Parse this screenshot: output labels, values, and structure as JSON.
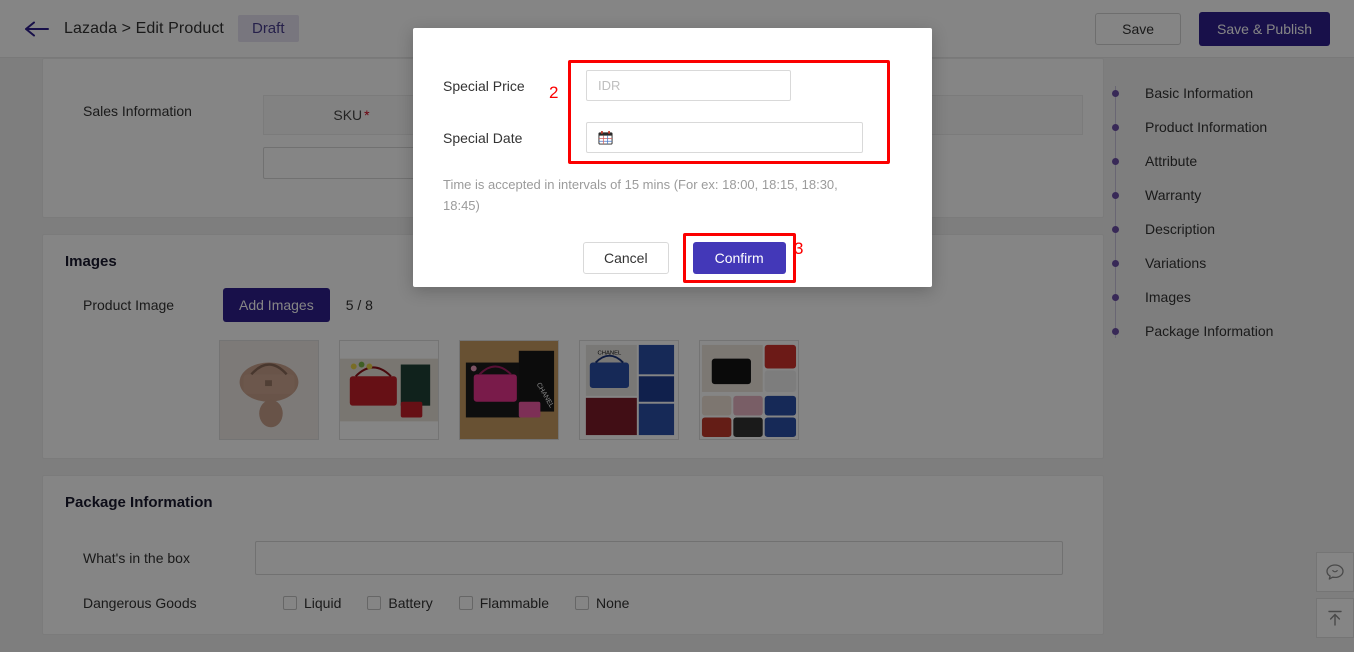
{
  "header": {
    "back_icon": "arrow-left-icon",
    "breadcrumb": "Lazada > Edit Product",
    "status_badge": "Draft",
    "save_label": "Save",
    "publish_label": "Save & Publish"
  },
  "sales_section": {
    "label": "Sales Information",
    "sku_header": "SKU",
    "required_mark": "*"
  },
  "images_section": {
    "title": "Images",
    "label": "Product Image",
    "add_button": "Add Images",
    "count": "5 / 8",
    "thumbnails": [
      {
        "alt": "beige quilted handbag on white fur"
      },
      {
        "alt": "red quilted handbag in box with branded packaging"
      },
      {
        "alt": "pink quilted handbag with black box"
      },
      {
        "alt": "blue handbag collage with brand card"
      },
      {
        "alt": "multi-color handbag collage"
      }
    ]
  },
  "package_section": {
    "title": "Package Information",
    "whats_in_box_label": "What's in the box",
    "whats_in_box_value": "",
    "dangerous_goods_label": "Dangerous Goods",
    "checkboxes": [
      {
        "label": "Liquid",
        "checked": false
      },
      {
        "label": "Battery",
        "checked": false
      },
      {
        "label": "Flammable",
        "checked": false
      },
      {
        "label": "None",
        "checked": false
      }
    ]
  },
  "sidenav": {
    "items": [
      {
        "label": "Basic Information"
      },
      {
        "label": "Product Information"
      },
      {
        "label": "Attribute"
      },
      {
        "label": "Warranty"
      },
      {
        "label": "Description"
      },
      {
        "label": "Variations"
      },
      {
        "label": "Images"
      },
      {
        "label": "Package Information"
      }
    ]
  },
  "floating_buttons": [
    {
      "icon": "chat-bubble-icon"
    },
    {
      "icon": "scroll-to-top-icon"
    }
  ],
  "modal": {
    "special_price_label": "Special Price",
    "special_price_placeholder": "IDR",
    "special_price_value": "",
    "special_date_label": "Special Date",
    "special_date_placeholder": "",
    "special_date_value": "",
    "calendar_icon": "calendar-icon",
    "help_text": "Time is accepted in intervals of 15 mins (For ex: 18:00, 18:15, 18:30, 18:45)",
    "cancel_label": "Cancel",
    "confirm_label": "Confirm"
  },
  "annotations": {
    "step_two": "2",
    "step_three": "3",
    "highlight_color": "#fb0000"
  },
  "colors": {
    "brand_purple": "#2e1f8e",
    "confirm_blue": "#4338b8",
    "draft_badge_bg": "#e6e3f2",
    "required_red": "#d0021b"
  }
}
